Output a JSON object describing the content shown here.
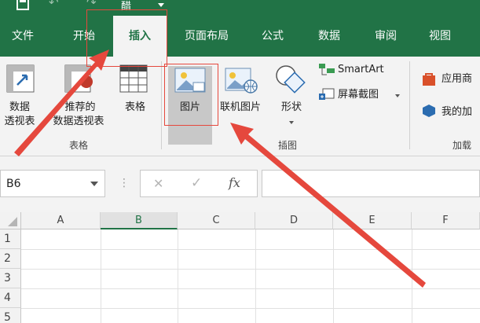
{
  "quick_access": {
    "redo_hint": "↷",
    "touch_icon": "醋"
  },
  "tabs": [
    {
      "label": "文件"
    },
    {
      "label": "开始"
    },
    {
      "label": "插入"
    },
    {
      "label": "页面布局"
    },
    {
      "label": "公式"
    },
    {
      "label": "数据"
    },
    {
      "label": "审阅"
    },
    {
      "label": "视图"
    }
  ],
  "ribbon": {
    "tables_group": {
      "label": "表格",
      "pivot_line1": "数据",
      "pivot_line2": "透视表",
      "rec_pivot_line1": "推荐的",
      "rec_pivot_line2": "数据透视表",
      "table": "表格"
    },
    "illustrations_group": {
      "label": "插图",
      "pictures": "图片",
      "online_pictures": "联机图片",
      "shapes": "形状",
      "smartart": "SmartArt",
      "screenshot": "屏幕截图"
    },
    "addins_group": {
      "label": "加载",
      "store": "应用商",
      "my_addins": "我的加"
    }
  },
  "formula_bar": {
    "name_box": "B6",
    "fx": "fx",
    "formula": ""
  },
  "grid": {
    "columns": [
      "A",
      "B",
      "C",
      "D",
      "E",
      "F"
    ],
    "selected_column": "B",
    "rows": [
      "1",
      "2",
      "3",
      "4",
      "5"
    ]
  },
  "colors": {
    "excel_green": "#217346",
    "annotation_red": "#e5483d"
  }
}
